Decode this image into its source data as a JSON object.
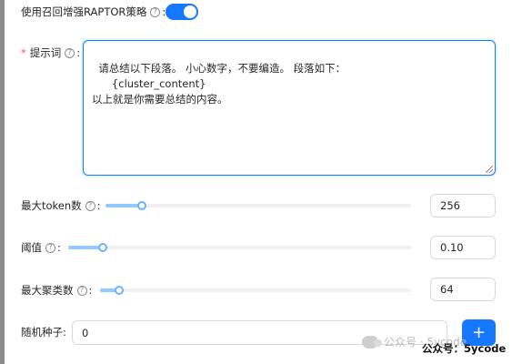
{
  "raptor": {
    "label": "使用召回增强RAPTOR策略",
    "help": "?",
    "enabled": true
  },
  "prompt": {
    "required_mark": "*",
    "label": "提示词",
    "help": "?",
    "value": "请总结以下段落。 小心数字，不要编造。 段落如下：\n      {cluster_content}\n以上就是你需要总结的内容。"
  },
  "max_token": {
    "label": "最大token数",
    "help": "?",
    "value": "256",
    "slider_fraction": 0.12
  },
  "threshold": {
    "label": "阈值",
    "help": "?",
    "value": "0.10",
    "slider_fraction": 0.1
  },
  "max_cluster": {
    "label": "最大聚类数",
    "help": "?",
    "value": "64",
    "slider_fraction": 0.06
  },
  "seed": {
    "label": "随机种子",
    "value": "0",
    "button_label": "+"
  },
  "watermark": {
    "faded_text": "公众号 · 5ycode",
    "text": "公众号：5ycode"
  },
  "colors": {
    "primary": "#1677ff",
    "slider_track": "#91caff",
    "required": "#ff4d4f"
  }
}
